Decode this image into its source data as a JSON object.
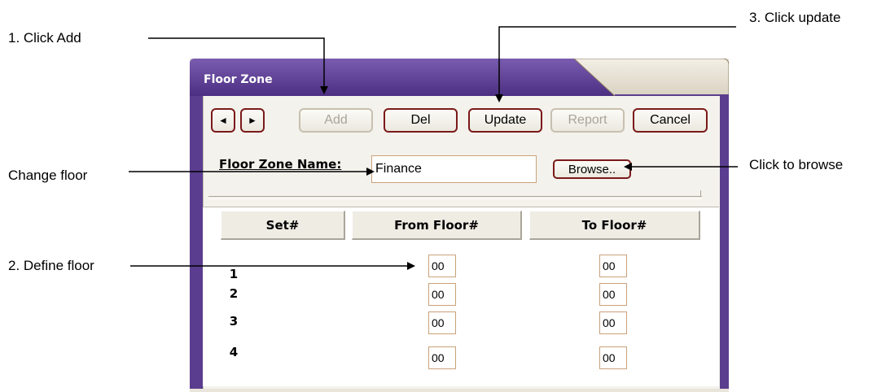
{
  "window": {
    "title": "Floor Zone",
    "colors": {
      "title_bar": "#5b3d8f",
      "frame": "#e9e5da",
      "button_border": "#7a1a1a",
      "field_border": "#caa27a"
    }
  },
  "toolbar": {
    "prev_icon": "triangle-left-icon",
    "next_icon": "triangle-right-icon",
    "prev_glyph": "◄",
    "next_glyph": "►",
    "add_label": "Add",
    "del_label": "Del",
    "update_label": "Update",
    "report_label": "Report",
    "cancel_label": "Cancel"
  },
  "form": {
    "zone_name_label": "Floor Zone Name:",
    "zone_name_value": "Finance",
    "browse_label": "Browse.."
  },
  "grid": {
    "headers": [
      "Set#",
      "From Floor#",
      "To Floor#"
    ],
    "rows": [
      {
        "set": "1",
        "from": "00",
        "to": "00"
      },
      {
        "set": "2",
        "from": "00",
        "to": "00"
      },
      {
        "set": "3",
        "from": "00",
        "to": "00"
      },
      {
        "set": "4",
        "from": "00",
        "to": "00"
      }
    ]
  },
  "callouts": {
    "click_add": "1. Click Add",
    "click_update": "3. Click update",
    "change_floor": "Change floor",
    "click_browse": "Click to browse",
    "define_floor": "2. Define floor"
  }
}
